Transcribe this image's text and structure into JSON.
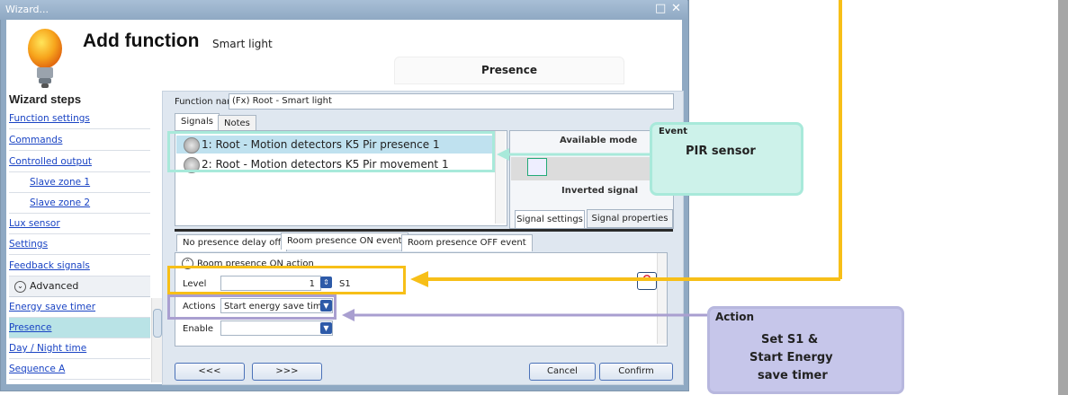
{
  "window": {
    "title": "Wizard...",
    "controls": [
      "□",
      "✕"
    ]
  },
  "header": {
    "title": "Add function",
    "subtitle": "Smart light",
    "tab": "Presence"
  },
  "nav": {
    "heading": "Wizard steps",
    "items": [
      "Function settings",
      "Commands",
      "Controlled output",
      "Slave zone 1",
      "Slave zone 2",
      "Lux sensor",
      "Settings",
      "Feedback signals"
    ],
    "advanced": "Advanced",
    "advanced_items": [
      "Energy save timer",
      "Presence",
      "Day / Night time",
      "Sequence A"
    ]
  },
  "function": {
    "label": "Function name:",
    "value": "(Fx) Root - Smart light"
  },
  "signal_tabs": [
    "Signals",
    "Notes"
  ],
  "signals": [
    "1: Root - Motion detectors K5 Pir presence 1",
    "2: Root - Motion detectors K5 Pir movement 1"
  ],
  "mode": {
    "available": "Available mode",
    "inverted": "Inverted signal",
    "tab_settings": "Signal settings",
    "tab_props": "Signal properties"
  },
  "event_tabs": [
    "No presence delay off",
    "Room presence ON event",
    "Room presence OFF event"
  ],
  "action": {
    "header": "Room presence ON action",
    "level_label": "Level",
    "level_value": "1",
    "level_unit": "S1",
    "actions_label": "Actions",
    "actions_value": "Start energy save tim...",
    "enable_label": "Enable",
    "enable_value": ""
  },
  "buttons": {
    "prev": "<<<",
    "next": ">>>",
    "cancel": "Cancel",
    "confirm": "Confirm"
  },
  "callouts": {
    "event_title": "Event",
    "event_text": "PIR sensor",
    "action_title": "Action",
    "action_lines": [
      "Set S1 &",
      "Start Energy",
      "save timer"
    ]
  },
  "colors": {
    "highlight_signal": "#a8e9da",
    "highlight_level": "#f7bf18",
    "highlight_action": "#a99fd0"
  }
}
